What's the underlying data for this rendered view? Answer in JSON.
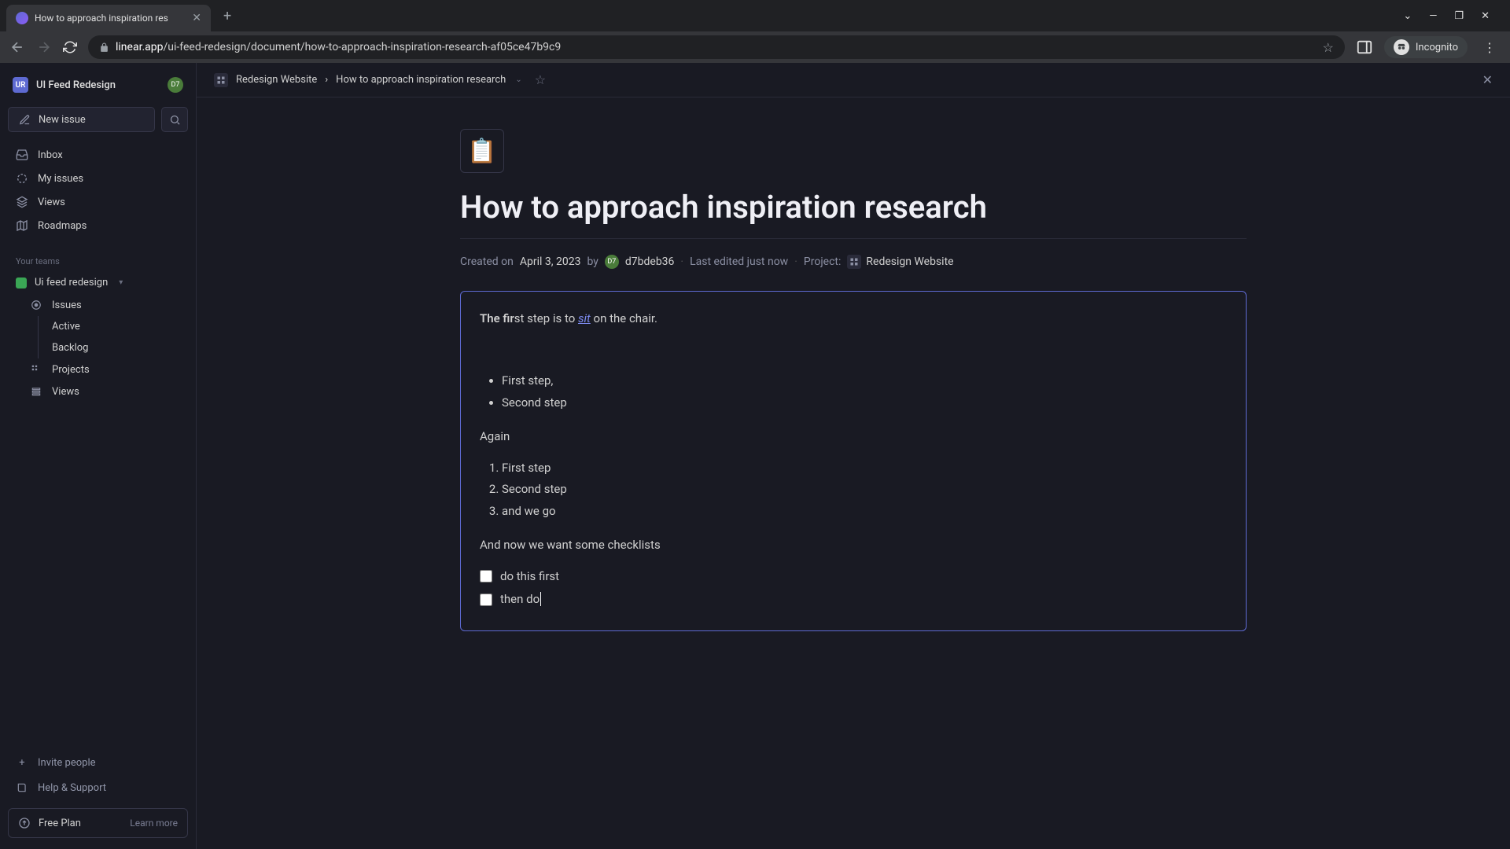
{
  "browser": {
    "tab_title": "How to approach inspiration res",
    "url_domain": "linear.app",
    "url_path": "/ui-feed-redesign/document/how-to-approach-inspiration-research-af05ce47b9c9",
    "incognito": "Incognito"
  },
  "sidebar": {
    "workspace": "UI Feed Redesign",
    "ws_code": "UR",
    "user_code": "D7",
    "new_issue": "New issue",
    "nav": [
      "Inbox",
      "My issues",
      "Views",
      "Roadmaps"
    ],
    "teams_label": "Your teams",
    "team": "Ui feed redesign",
    "sub": {
      "issues": "Issues",
      "active": "Active",
      "backlog": "Backlog",
      "projects": "Projects",
      "views": "Views"
    },
    "invite": "Invite people",
    "help": "Help & Support",
    "plan": "Free Plan",
    "learn": "Learn more"
  },
  "crumb": {
    "project": "Redesign Website",
    "sep": "›",
    "doc": "How to approach inspiration research"
  },
  "doc": {
    "emoji": "📋",
    "title": "How to approach inspiration research",
    "created_label": "Created on",
    "created_date": "April 3, 2023",
    "by_label": "by",
    "author": "d7bdeb36",
    "edited": "Last edited just now",
    "project_label": "Project:",
    "project": "Redesign Website"
  },
  "content": {
    "p1_a": "The fir",
    "p1_b": "st step is to ",
    "p1_link": "sit",
    "p1_c": " on the chair.",
    "bullets": [
      "First step,",
      "Second step"
    ],
    "again": "Again",
    "numbers": [
      "First step",
      "Second step",
      "and we go"
    ],
    "check_intro": "And now we want some checklists",
    "checks": [
      "do this first",
      "then do"
    ]
  }
}
